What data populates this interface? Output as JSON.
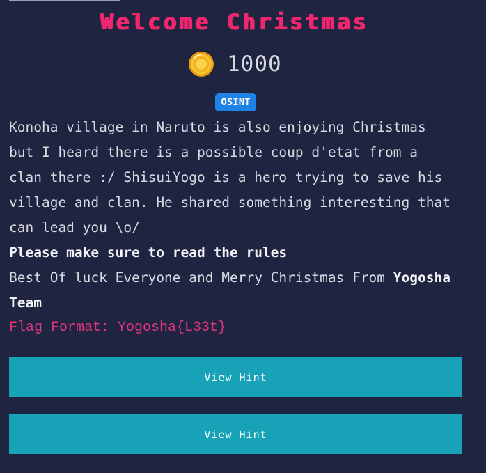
{
  "challenge": {
    "title": "Welcome Christmas",
    "points": "1000",
    "category": "OSINT",
    "description_lines": [
      "Konoha village in Naruto is also enjoying Christmas",
      "but I heard there is a possible coup d'etat from a",
      "clan there :/ ShisuiYogo is a hero trying to save his",
      "village and clan. He shared something interesting that",
      "can lead you \\o/"
    ],
    "rules_note": "Please make sure to read the rules",
    "closing_prefix": "Best Of luck Everyone and Merry Christmas From ",
    "closing_bold": "Yogosha",
    "closing_bold_line2": "Team",
    "flag_format": "Flag Format: Yogosha{L33t}"
  },
  "hints": [
    {
      "label": "View Hint"
    },
    {
      "label": "View Hint"
    }
  ],
  "colors": {
    "background": "#1f2440",
    "title": "#f0266f",
    "badge": "#1f82e6",
    "flag_format": "#e0357c",
    "hint_button": "#17a2b8"
  },
  "icons": {
    "points": "coin-icon"
  }
}
